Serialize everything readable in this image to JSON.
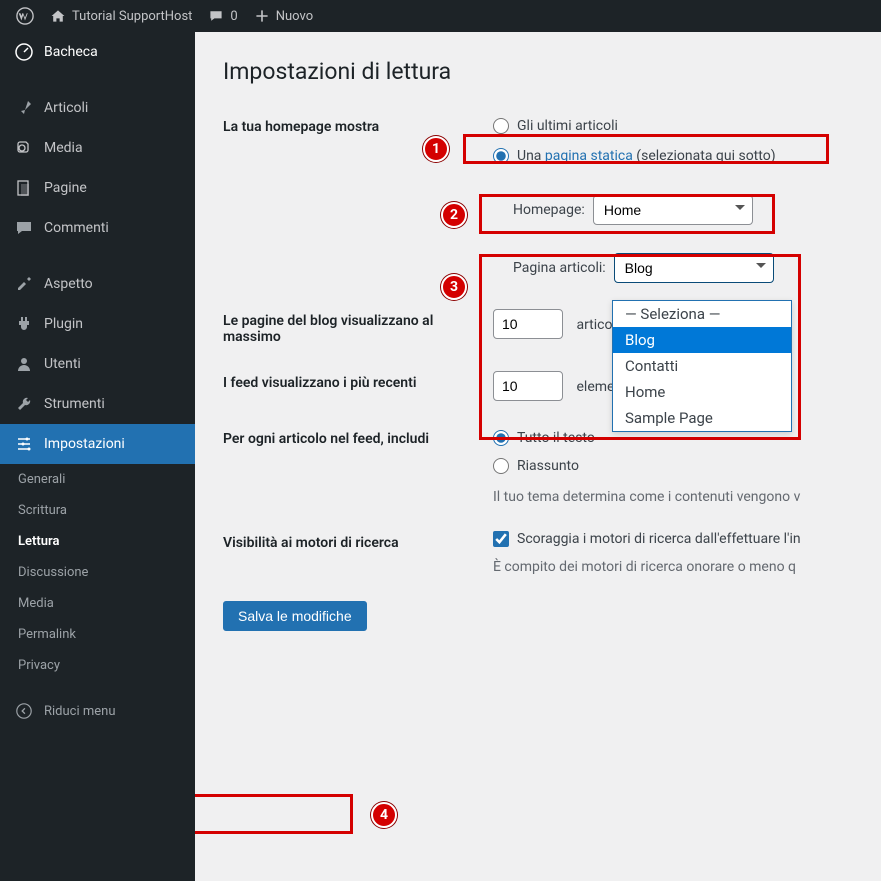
{
  "adminbar": {
    "site_name": "Tutorial SupportHost",
    "comments_count": "0",
    "new_label": "Nuovo"
  },
  "sidebar": {
    "items": [
      {
        "label": "Bacheca"
      },
      {
        "label": "Articoli"
      },
      {
        "label": "Media"
      },
      {
        "label": "Pagine"
      },
      {
        "label": "Commenti"
      },
      {
        "label": "Aspetto"
      },
      {
        "label": "Plugin"
      },
      {
        "label": "Utenti"
      },
      {
        "label": "Strumenti"
      },
      {
        "label": "Impostazioni"
      }
    ],
    "submenu": [
      {
        "label": "Generali"
      },
      {
        "label": "Scrittura"
      },
      {
        "label": "Lettura"
      },
      {
        "label": "Discussione"
      },
      {
        "label": "Media"
      },
      {
        "label": "Permalink"
      },
      {
        "label": "Privacy"
      }
    ],
    "collapse_label": "Riduci menu"
  },
  "page": {
    "title": "Impostazioni di lettura",
    "homepage_th": "La tua homepage mostra",
    "radio_latest": "Gli ultimi articoli",
    "radio_static_pre": "Una ",
    "radio_static_link": "pagina statica",
    "radio_static_post": " (selezionata qui sotto)",
    "homepage_label": "Homepage:",
    "homepage_value": "Home",
    "posts_page_label": "Pagina articoli:",
    "posts_page_value": "Blog",
    "posts_options": [
      "— Seleziona —",
      "Blog",
      "Contatti",
      "Home",
      "Sample Page"
    ],
    "selected_option_index": 1,
    "blog_pages_th": "Le pagine del blog visualizzano al massimo",
    "blog_pages_value": "10",
    "blog_pages_unit": "articoli",
    "feed_th": "I feed visualizzano i più recenti",
    "feed_value": "10",
    "feed_unit": "elementi",
    "feed_content_th": "Per ogni articolo nel feed, includi",
    "feed_full": "Tutto il testo",
    "feed_summary": "Riassunto",
    "feed_desc": "Il tuo tema determina come i contenuti vengono v",
    "seo_th": "Visibilità ai motori di ricerca",
    "seo_cb": "Scoraggia i motori di ricerca dall'effettuare l'in",
    "seo_desc": "È compito dei motori di ricerca onorare o meno q",
    "save_label": "Salva le modifiche"
  },
  "annotations": {
    "b1": "1",
    "b2": "2",
    "b3": "3",
    "b4": "4"
  }
}
